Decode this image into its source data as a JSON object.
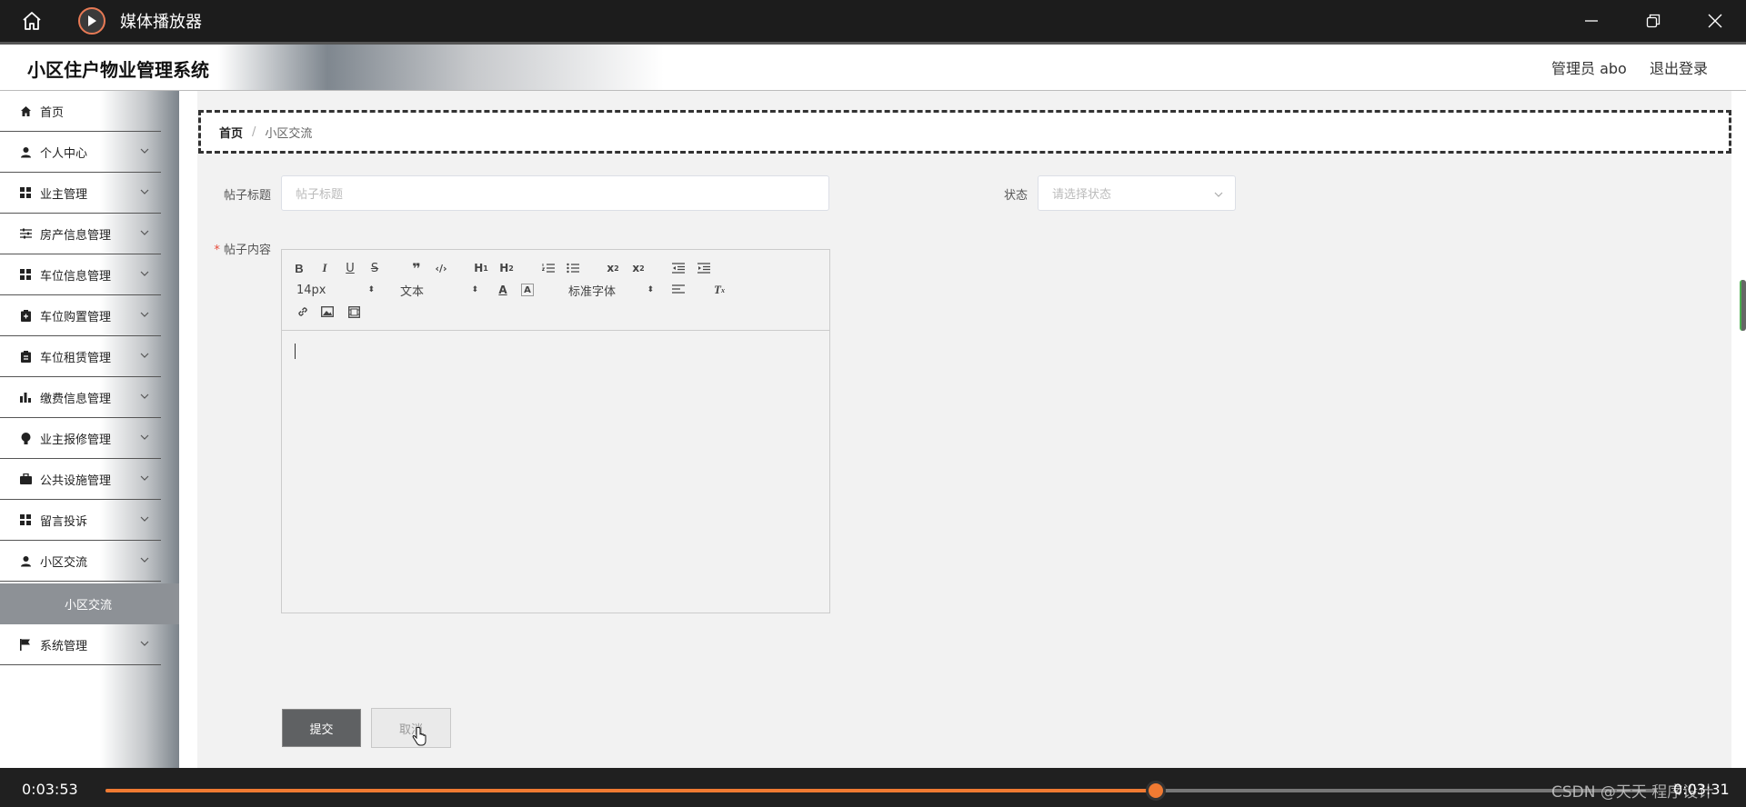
{
  "player": {
    "title": "媒体播放器",
    "current_time": "0:03:53",
    "total_time": "0:03:31",
    "progress": 0.677,
    "watermark": "CSDN @天天 程序设计"
  },
  "header": {
    "system_title": "小区住户物业管理系统",
    "user": "管理员 abo",
    "logout": "退出登录"
  },
  "sidebar": {
    "items": [
      {
        "label": "首页",
        "icon": "home-icon",
        "chevron": false
      },
      {
        "label": "个人中心",
        "icon": "user-icon",
        "chevron": true
      },
      {
        "label": "业主管理",
        "icon": "grid-icon",
        "chevron": true
      },
      {
        "label": "房产信息管理",
        "icon": "sliders-icon",
        "chevron": true
      },
      {
        "label": "车位信息管理",
        "icon": "grid-icon",
        "chevron": true
      },
      {
        "label": "车位购置管理",
        "icon": "clipboard-icon",
        "chevron": true
      },
      {
        "label": "车位租赁管理",
        "icon": "clipboard-icon",
        "chevron": true
      },
      {
        "label": "缴费信息管理",
        "icon": "bar-chart-icon",
        "chevron": true
      },
      {
        "label": "业主报修管理",
        "icon": "bulb-icon",
        "chevron": true
      },
      {
        "label": "公共设施管理",
        "icon": "briefcase-icon",
        "chevron": true
      },
      {
        "label": "留言投诉",
        "icon": "grid-icon",
        "chevron": true
      },
      {
        "label": "小区交流",
        "icon": "user-icon",
        "chevron": true
      },
      {
        "label": "系统管理",
        "icon": "flag-icon",
        "chevron": true
      }
    ],
    "active_sub": "小区交流"
  },
  "breadcrumb": {
    "home": "首页",
    "separator": "/",
    "current": "小区交流"
  },
  "form": {
    "title_label": "帖子标题",
    "title_placeholder": "帖子标题",
    "status_label": "状态",
    "status_placeholder": "请选择状态",
    "content_required_mark": "*",
    "content_label": "帖子内容",
    "submit_label": "提交",
    "cancel_label": "取消"
  },
  "editor": {
    "font_size": "14px",
    "text_type": "文本",
    "font_family": "标准字体"
  }
}
